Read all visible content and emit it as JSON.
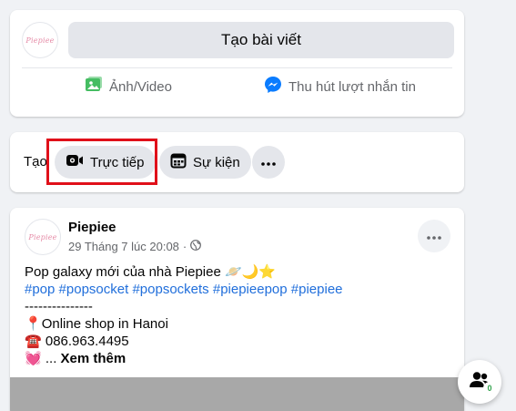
{
  "composer": {
    "avatar_text": "Piepiee",
    "create_post_label": "Tạo bài viết",
    "actions": [
      {
        "label": "Ảnh/Video",
        "icon": "photo-video-icon",
        "color": "#45bd62"
      },
      {
        "label": "Thu hút lượt nhắn tin",
        "icon": "messenger-icon",
        "color": "#0a7cff"
      }
    ]
  },
  "create_row": {
    "label": "Tạo",
    "live_label": "Trực tiếp",
    "event_label": "Sự kiện",
    "more_icon": "more-icon",
    "highlight_color": "#e0101a"
  },
  "post": {
    "avatar_text": "Piepiee",
    "author": "Piepiee",
    "timestamp": "29 Tháng 7 lúc 20:08",
    "separator": "·",
    "privacy_icon": "globe-icon",
    "line1_text": "Pop galaxy mới của nhà Piepiee",
    "line1_emoji": "🪐🌙⭐",
    "hashtags": [
      "#pop",
      "#popsocket",
      "#popsockets",
      "#piepieepop",
      "#piepiee"
    ],
    "divider": "---------------",
    "shop_emoji": "📍",
    "shop_text": "Online shop in Hanoi",
    "phone_emoji": "☎️",
    "phone": "086.963.4495",
    "heart_emoji": "💓",
    "ellipsis": "...",
    "see_more": "Xem thêm"
  },
  "contacts_fab": {
    "icon": "contacts-icon",
    "badge": "0"
  },
  "colors": {
    "background": "#f0f2f5",
    "hashtag": "#216fdb",
    "secondary_text": "#65676b"
  }
}
